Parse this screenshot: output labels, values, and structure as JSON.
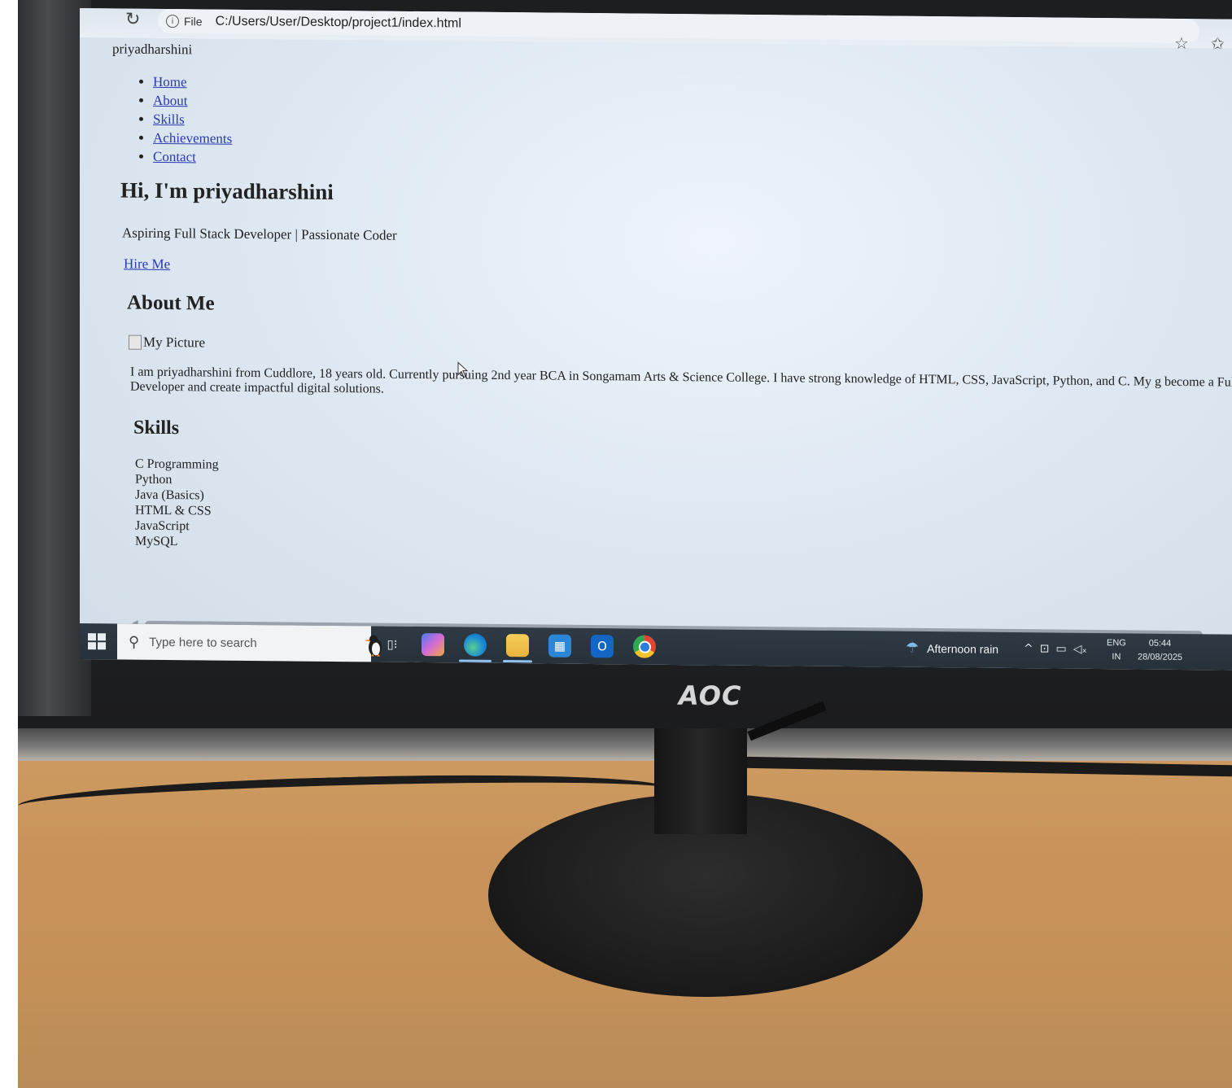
{
  "browser": {
    "file_label": "File",
    "url": "C:/Users/User/Desktop/project1/index.html",
    "icons": [
      "reload-icon",
      "info-icon",
      "star-icon",
      "favorites-icon"
    ]
  },
  "page": {
    "brand": "priyadharshini",
    "nav": [
      "Home",
      "About",
      "Skills",
      "Achievements",
      "Contact"
    ],
    "hero_title": "Hi, I'm priyadharshini",
    "tagline": "Aspiring Full Stack Developer | Passionate Coder",
    "hire_link": "Hire Me",
    "about_heading": "About Me",
    "picture_alt": "My Picture",
    "about_text": "I am priyadharshini from Cuddlore, 18 years old. Currently pursuing 2nd year BCA in Songamam Arts & Science College. I have strong knowledge of HTML, CSS, JavaScript, Python, and C. My g become a Full-Stack Developer and create impactful digital solutions.",
    "skills_heading": "Skills",
    "skills": [
      "C Programming",
      "Python",
      "Java (Basics)",
      "HTML & CSS",
      "JavaScript",
      "MySQL"
    ]
  },
  "taskbar": {
    "search_placeholder": "Type here to search",
    "weather": "Afternoon rain",
    "lang_top": "ENG",
    "lang_bottom": "IN",
    "time": "05:44",
    "date": "28/08/2025",
    "icons": [
      "windows-start-icon",
      "search-icon",
      "task-view-icon",
      "copilot-icon",
      "edge-icon",
      "file-explorer-icon",
      "store-icon",
      "outlook-icon",
      "chrome-icon",
      "weather-icon",
      "chevron-up-icon",
      "network-icon",
      "display-icon",
      "volume-muted-icon"
    ]
  },
  "monitor": {
    "brand": "AOC"
  },
  "colors": {
    "link": "#2a3bb0",
    "taskbar": "#2f3a44",
    "desk": "#c8935a"
  }
}
